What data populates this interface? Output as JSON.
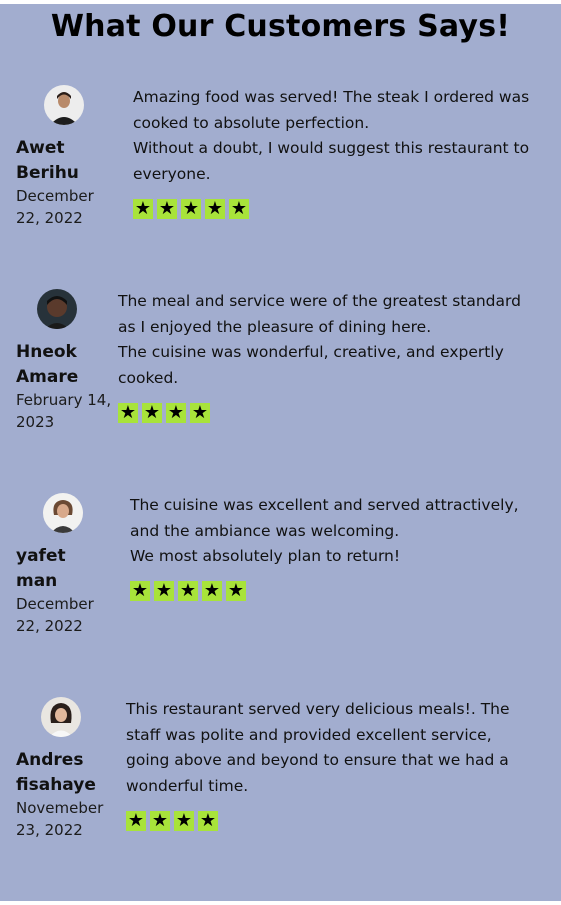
{
  "title": "What Our Customers Says!",
  "reviews": [
    {
      "name": "Awet Berihu",
      "date": "December 22, 2022",
      "line1": "Amazing food was served! The steak I ordered was cooked to absolute perfection.",
      "line2": "Without a doubt, I would suggest this restaurant to everyone.",
      "rating": 5,
      "avatar_icon": "avatar-man-portrait"
    },
    {
      "name": "Hneok Amare",
      "date": "February 14, 2023",
      "line1": "The meal and service were of the greatest standard as I enjoyed the pleasure of dining here.",
      "line2": "The cuisine was wonderful, creative, and expertly cooked.",
      "rating": 4,
      "avatar_icon": "avatar-man-dark-portrait"
    },
    {
      "name": "yafet man",
      "date": "December 22, 2022",
      "line1": "The cuisine was excellent and served attractively, and the ambiance was welcoming.",
      "line2": "We most absolutely plan to return!",
      "rating": 5,
      "avatar_icon": "avatar-woman-portrait"
    },
    {
      "name": "Andres fisahaye",
      "date": "Novemeber 23, 2022",
      "line1": "This restaurant served very delicious meals!. The staff was polite and provided excellent service,",
      "line2": "going above and beyond to ensure that we had a wonderful time.",
      "rating": 4,
      "avatar_icon": "avatar-woman-smiling-portrait"
    }
  ],
  "colors": {
    "background": "#a2adcf",
    "star_background": "#a8e33a"
  }
}
